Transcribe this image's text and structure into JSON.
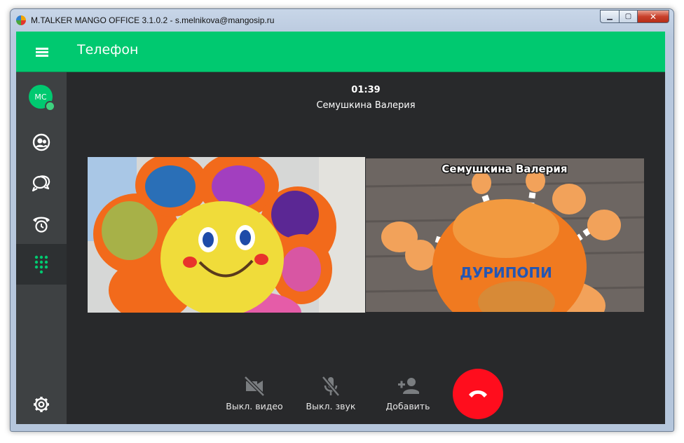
{
  "window": {
    "title": "M.TALKER MANGO OFFICE 3.1.0.2 - s.melnikova@mangosip.ru",
    "controls": {
      "minimize": "▁",
      "maximize": "▢",
      "close": "✕"
    }
  },
  "appbar": {
    "title": "Телефон"
  },
  "sidebar": {
    "avatar_initials": "MC",
    "items": [
      {
        "id": "contacts",
        "icon": "contacts-icon"
      },
      {
        "id": "chats",
        "icon": "chat-icon"
      },
      {
        "id": "history",
        "icon": "call-history-icon"
      },
      {
        "id": "dialpad",
        "icon": "dialpad-icon",
        "active": true
      }
    ],
    "settings_icon": "gear-icon"
  },
  "call": {
    "timer": "01:39",
    "caller_name": "Семушкина Валерия",
    "remote_video_label": "Семушкина Валерия"
  },
  "controls": {
    "video_off": "Выкл. видео",
    "mute": "Выкл. звук",
    "add": "Добавить"
  },
  "colors": {
    "accent": "#00c970",
    "sidebar": "#3e4143",
    "background": "#28292b",
    "hangup": "#ff0d1d",
    "active_icon": "#00c970"
  }
}
